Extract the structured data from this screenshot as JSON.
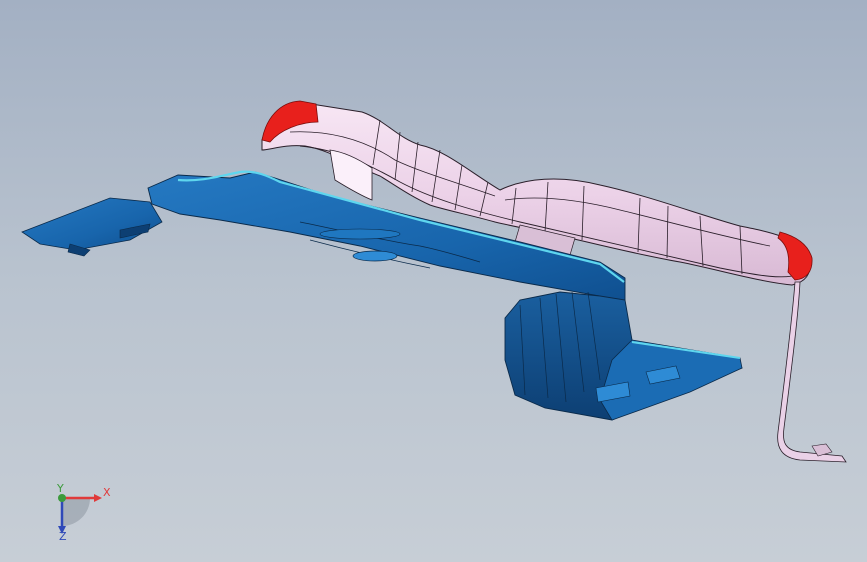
{
  "viewport": {
    "background_top": "#a3b0c3",
    "background_bottom": "#c7ced6"
  },
  "model": {
    "part_upper_color": "#efd6ec",
    "part_lower_color": "#1b6cb4",
    "highlight_color": "#e8201c",
    "edge_highlight_color": "#5fd6ee"
  },
  "triad": {
    "x_label": "X",
    "y_label": "Y",
    "z_label": "Z",
    "x_color": "#e03a3a",
    "y_color": "#3c9a3c",
    "z_color": "#2f49b8"
  }
}
